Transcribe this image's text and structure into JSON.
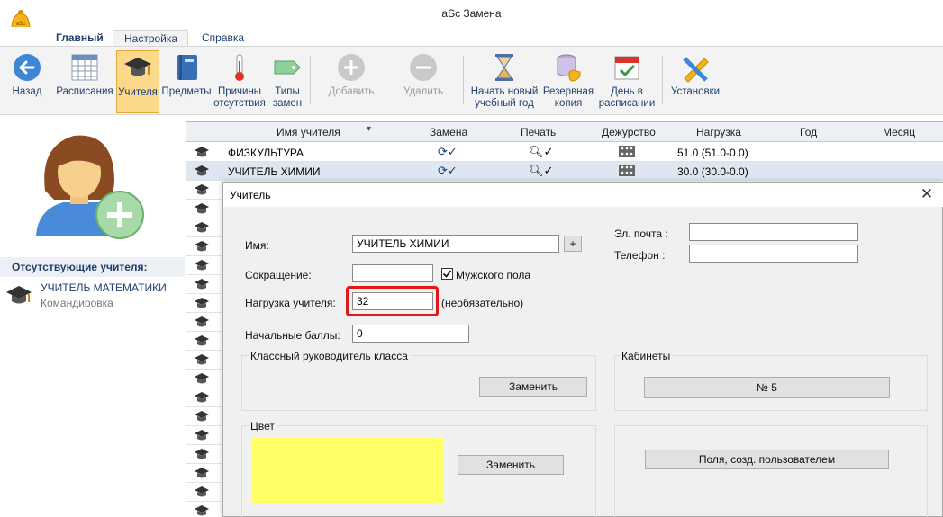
{
  "window": {
    "title": "aSc Замена"
  },
  "tabs": [
    {
      "label": "Главный"
    },
    {
      "label": "Настройка"
    },
    {
      "label": "Справка"
    }
  ],
  "ribbon": {
    "back": "Назад",
    "schedules": "Расписания",
    "teachers": "Учителя",
    "subjects": "Предметы",
    "absence_reasons": "Причины отсутствия",
    "substitution_types": "Типы замен",
    "add": "Добавить",
    "delete": "Удалить",
    "new_year": "Начать новый учебный год",
    "backup": "Резервная копия",
    "day_in_schedule": "День в расписании",
    "settings": "Установки"
  },
  "left_panel": {
    "absent_header": "Отсутствующие учителя:",
    "absent_teachers": [
      {
        "name": "УЧИТЕЛЬ МАТЕМАТИКИ",
        "reason": "Командировка"
      }
    ]
  },
  "grid": {
    "columns": [
      "Имя учителя",
      "Замена",
      "Печать",
      "Дежурство",
      "Нагрузка",
      "Год",
      "Месяц"
    ],
    "rows": [
      {
        "name": "ФИЗКУЛЬТУРА",
        "load": "51.0 (51.0-0.0)"
      },
      {
        "name": "УЧИТЕЛЬ ХИМИИ",
        "load": "30.0 (30.0-0.0)"
      }
    ]
  },
  "dialog": {
    "title": "Учитель",
    "name_label": "Имя:",
    "name_value": "УЧИТЕЛЬ ХИМИИ",
    "plus": "+",
    "short_label": "Сокращение:",
    "short_value": "",
    "male_label": "Мужского пола",
    "male_checked": true,
    "load_label": "Нагрузка учителя:",
    "load_value": "32",
    "optional": "(необязательно)",
    "points_label": "Начальные баллы:",
    "points_value": "0",
    "email_label": "Эл. почта :",
    "email_value": "",
    "phone_label": "Телефон :",
    "phone_value": "",
    "class_teacher_label": "Классный руководитель класса",
    "replace_btn": "Заменить",
    "rooms_label": "Кабинеты",
    "room_value": "№ 5",
    "color_label": "Цвет",
    "color_value": "#ffff66",
    "color_replace_btn": "Заменить",
    "custom_fields_btn": "Поля, созд. пользователем"
  },
  "colors": {
    "accent": "#1f3f6f",
    "highlight": "#e01818",
    "selected_row": "#dde6f1"
  }
}
